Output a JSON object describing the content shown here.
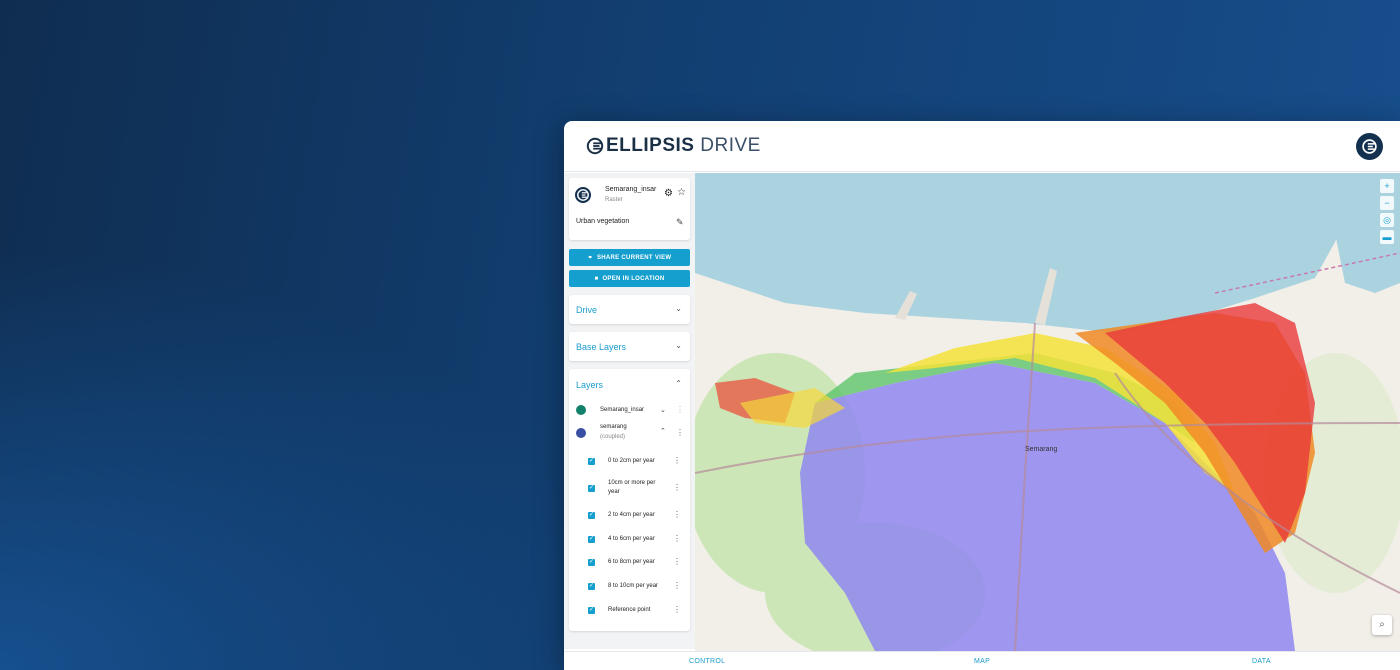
{
  "app": {
    "logo_bold": "ELLIPSIS",
    "logo_light": "DRIVE",
    "user_icon": "ellipsis-avatar-icon"
  },
  "layer_card": {
    "name": "Semarang_insar",
    "type": "Raster",
    "description": "Urban vegetation",
    "gear_icon": "gear-icon",
    "star_icon": "star-icon",
    "edit_icon": "pencil-icon"
  },
  "actions": {
    "share_label": "SHARE CURRENT VIEW",
    "open_label": "OPEN IN LOCATION"
  },
  "sections": {
    "drive": "Drive",
    "base_layers": "Base Layers",
    "layers": "Layers"
  },
  "layers": [
    {
      "name": "Semarang_insar",
      "color": "#12806b"
    },
    {
      "name": "semarang",
      "sub": "(coupled)",
      "color": "#3a4fa3"
    }
  ],
  "sublayers": [
    {
      "label": "0 to 2cm per year"
    },
    {
      "label": "10cm or more per year"
    },
    {
      "label": "2 to 4cm per year"
    },
    {
      "label": "4 to 6cm per year"
    },
    {
      "label": "6 to 8cm per year"
    },
    {
      "label": "8 to 10cm per year"
    },
    {
      "label": "Reference point"
    }
  ],
  "map": {
    "city_label": "Semarang",
    "sea_color": "#aad3df",
    "land_color": "#f2efe9"
  },
  "bottom_nav": {
    "control": "CONTROL",
    "map": "MAP",
    "data": "DATA"
  }
}
